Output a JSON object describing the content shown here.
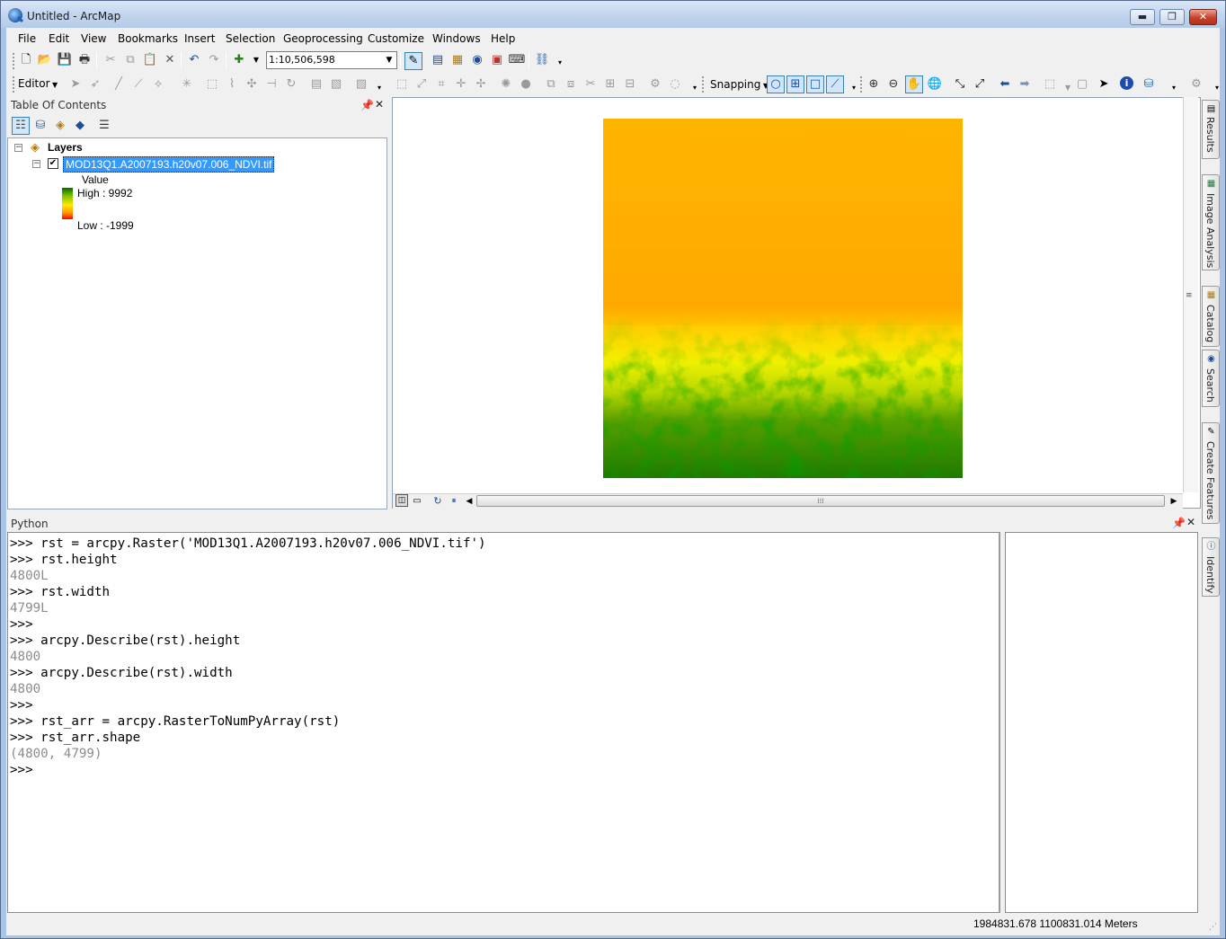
{
  "window": {
    "title": "Untitled - ArcMap",
    "buttons": {
      "minimize": "▬",
      "maximize": "❐",
      "close": "✕"
    }
  },
  "menubar": [
    "File",
    "Edit",
    "View",
    "Bookmarks",
    "Insert",
    "Selection",
    "Geoprocessing",
    "Customize",
    "Windows",
    "Help"
  ],
  "standard_toolbar": {
    "scale": "1:10,506,598",
    "icons": [
      "new-icon",
      "open-icon",
      "save-icon",
      "print-icon",
      "cut-icon",
      "copy-icon",
      "paste-icon",
      "delete-icon",
      "undo-icon",
      "redo-icon",
      "add-data-icon",
      "editor-toolbar-icon",
      "toc-icon",
      "catalog-icon",
      "search-icon",
      "arctoolbox-icon",
      "python-icon",
      "modelbuilder-icon"
    ]
  },
  "editor_toolbar": {
    "editor_label": "Editor",
    "snapping_label": "Snapping"
  },
  "toc": {
    "title": "Table Of Contents",
    "layers_label": "Layers",
    "layer_name": "MOD13Q1.A2007193.h20v07.006_NDVI.tif",
    "legend_title": "Value",
    "legend_high": "High : 9992",
    "legend_low": "Low : -1999",
    "ramp_colors": [
      "#006b00",
      "#7dc100",
      "#ffea00",
      "#ff9500",
      "#ff0000"
    ]
  },
  "python": {
    "title": "Python",
    "lines": [
      {
        "text": ">>> rst = arcpy.Raster('MOD13Q1.A2007193.h20v07.006_NDVI.tif')",
        "type": "input"
      },
      {
        "text": ">>> rst.height",
        "type": "input"
      },
      {
        "text": "4800L",
        "type": "output"
      },
      {
        "text": ">>> rst.width",
        "type": "input"
      },
      {
        "text": "4799L",
        "type": "output"
      },
      {
        "text": ">>>",
        "type": "input"
      },
      {
        "text": ">>> arcpy.Describe(rst).height",
        "type": "input"
      },
      {
        "text": "4800",
        "type": "output"
      },
      {
        "text": ">>> arcpy.Describe(rst).width",
        "type": "input"
      },
      {
        "text": "4800",
        "type": "output"
      },
      {
        "text": ">>>",
        "type": "input"
      },
      {
        "text": ">>> rst_arr = arcpy.RasterToNumPyArray(rst)",
        "type": "input"
      },
      {
        "text": ">>> rst_arr.shape",
        "type": "input"
      },
      {
        "text": "(4800, 4799)",
        "type": "output"
      },
      {
        "text": ">>>",
        "type": "input"
      }
    ]
  },
  "dock_tabs": [
    "Results",
    "Image Analysis",
    "Catalog",
    "Search",
    "Create Features",
    "Identify"
  ],
  "status": {
    "coordinates": "1984831.678  1100831.014 Meters"
  }
}
